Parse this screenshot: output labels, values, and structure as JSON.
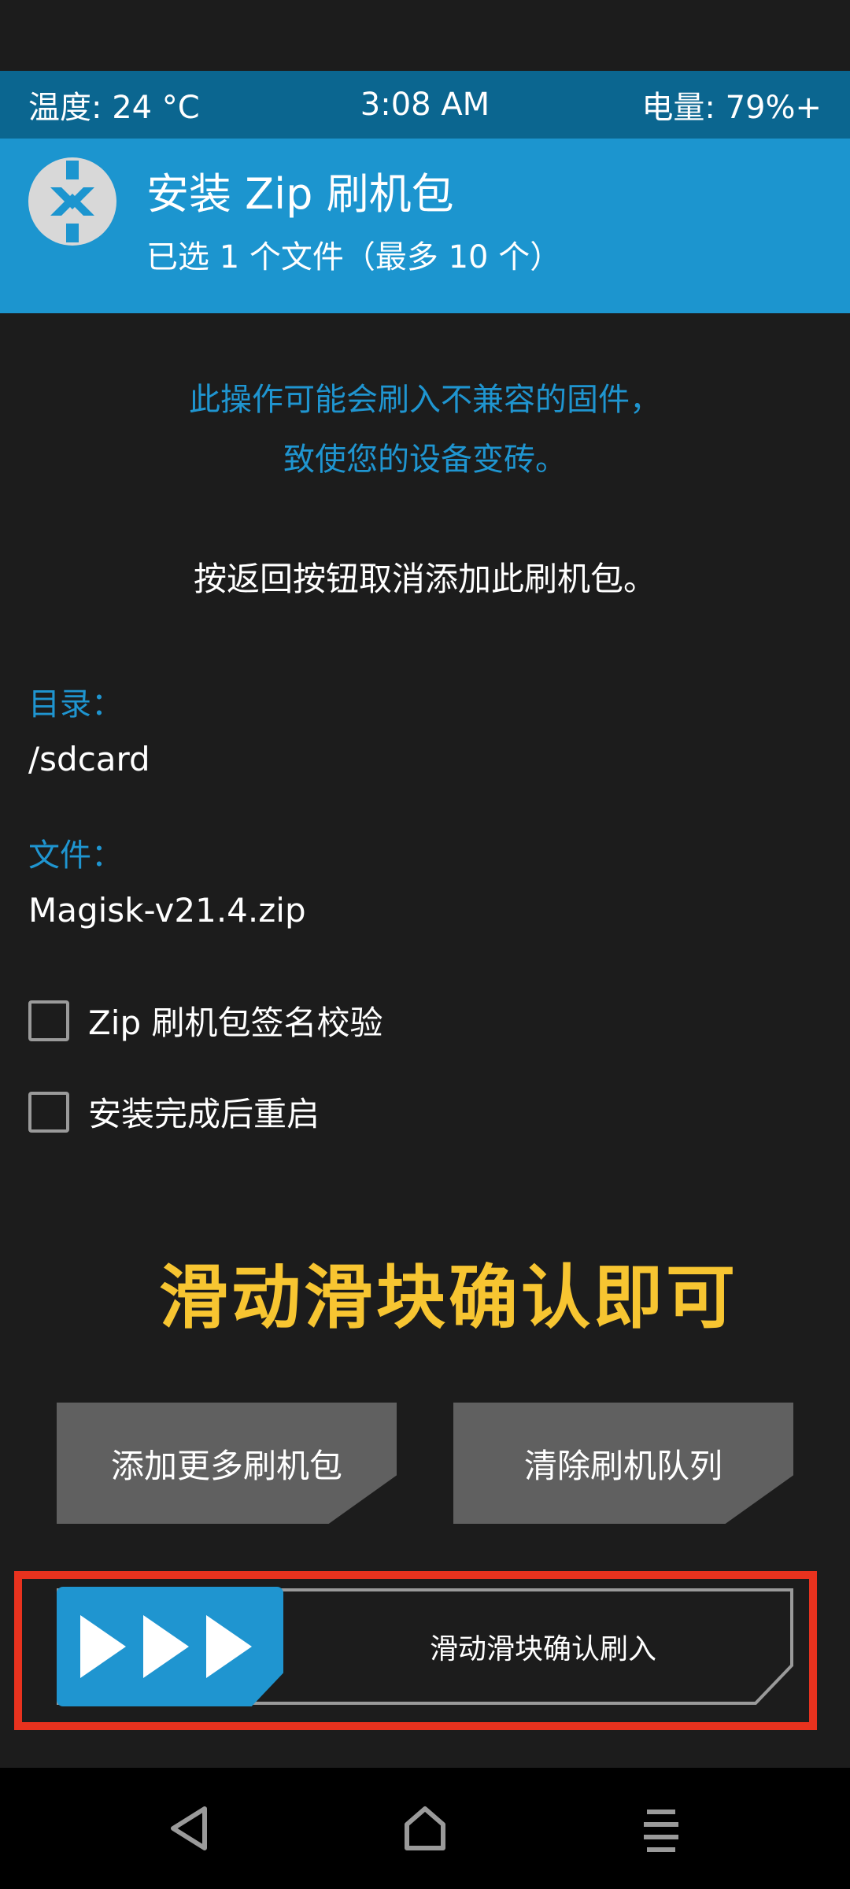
{
  "status_bar": {
    "temperature": "温度: 24 °C",
    "time": "3:08 AM",
    "battery": "电量: 79%+"
  },
  "header": {
    "title": "安装 Zip 刷机包",
    "subtitle": "已选 1 个文件（最多 10 个）",
    "logo_icon": "twrp-logo-icon"
  },
  "warning": {
    "line1": "此操作可能会刷入不兼容的固件，",
    "line2": "致使您的设备变砖。"
  },
  "hint": "按返回按钮取消添加此刷机包。",
  "directory": {
    "label": "目录：",
    "value": "/sdcard"
  },
  "file": {
    "label": "文件：",
    "value": "Magisk-v21.4.zip"
  },
  "options": [
    {
      "label": "Zip 刷机包签名校验",
      "checked": false
    },
    {
      "label": "安装完成后重启",
      "checked": false
    }
  ],
  "prompt": "滑动滑块确认即可",
  "buttons": {
    "add": "添加更多刷机包",
    "clear": "清除刷机队列"
  },
  "slider": {
    "label": "滑动滑块确认刷入",
    "handle_icon": "triple-arrow-right-icon"
  },
  "nav": {
    "back_icon": "back-triangle-icon",
    "home_icon": "home-icon",
    "menu_icon": "menu-icon"
  },
  "colors": {
    "accent": "#1f95d0",
    "status_bar": "#0b6690",
    "prompt": "#f7c531",
    "highlight": "#e8321e",
    "background": "#1c1c1c"
  }
}
